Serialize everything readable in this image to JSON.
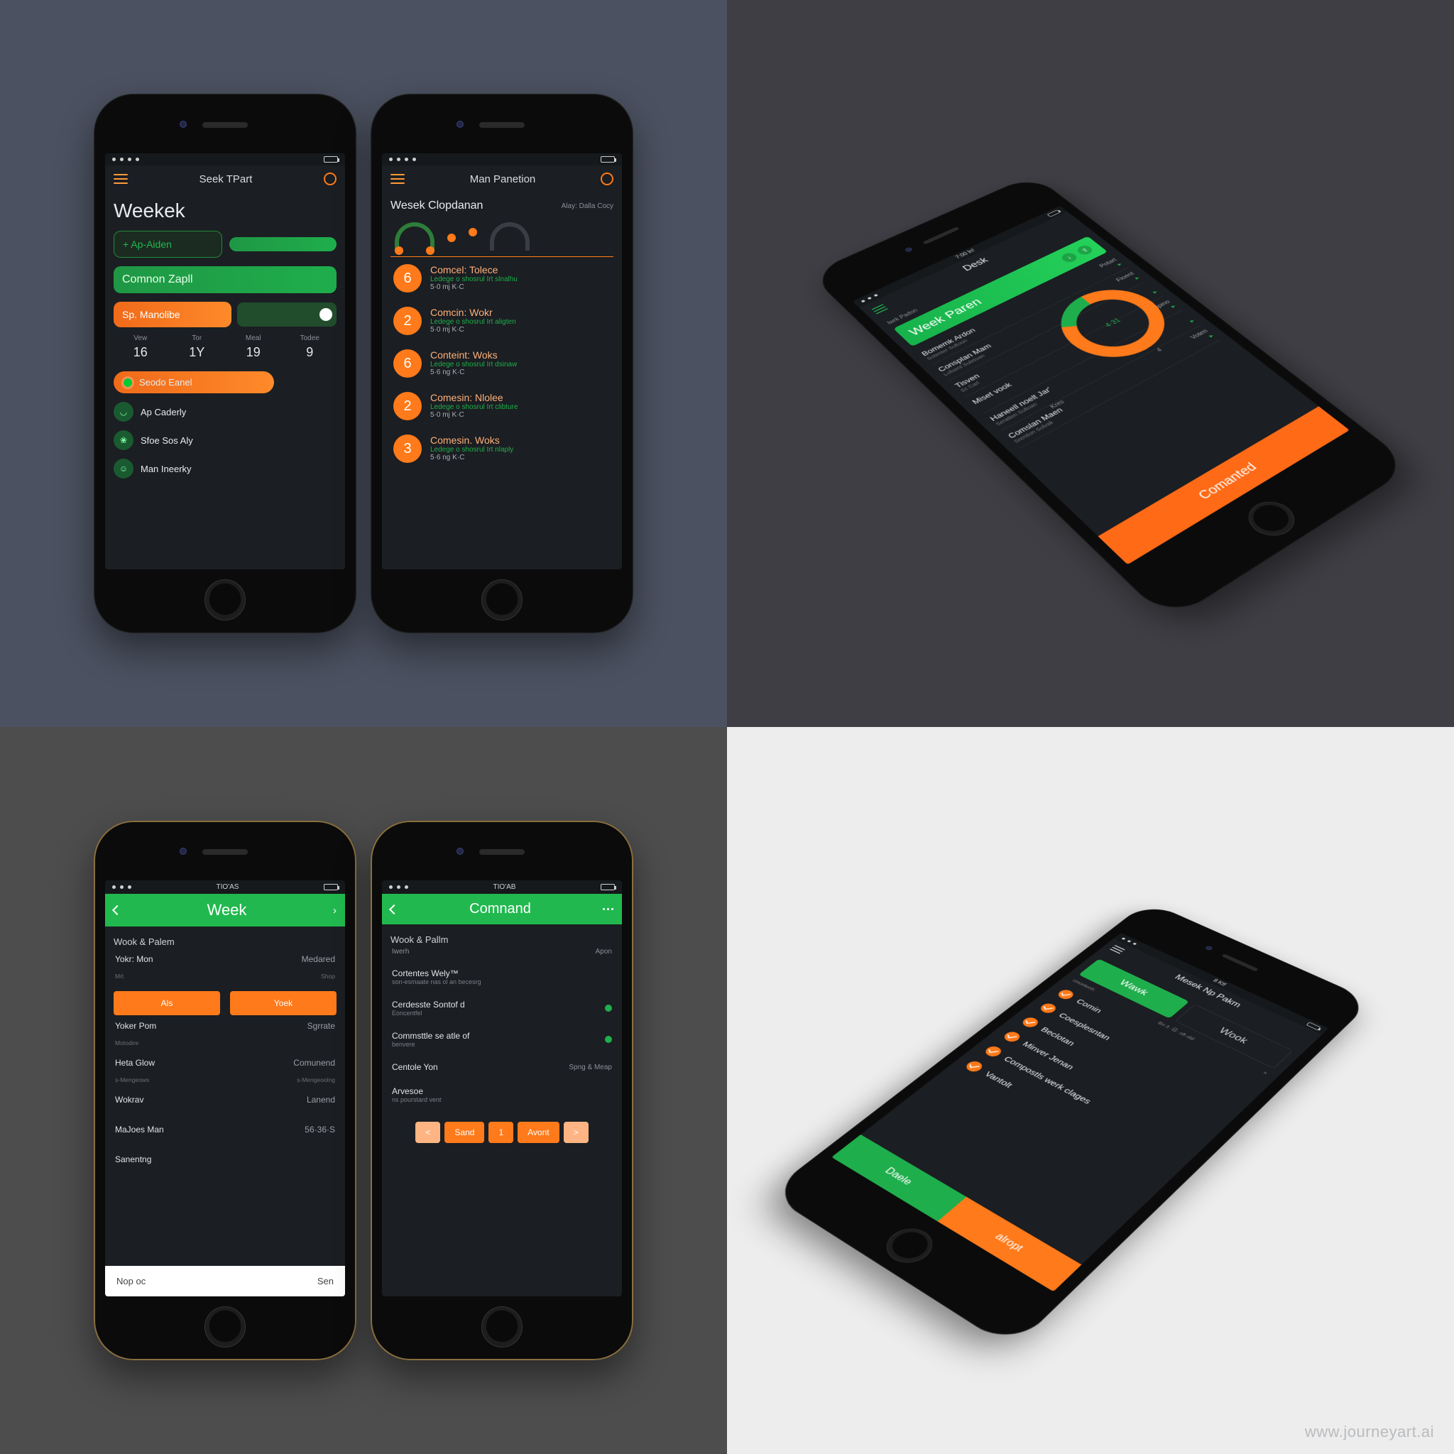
{
  "watermark": "www.journeyart.ai",
  "q1": {
    "left": {
      "status_time": "",
      "topbar_title": "Seek TPart",
      "h1": "Weekek",
      "add_btn": "+ Ap-Aiden",
      "banner": "Comnon Zapll",
      "action_btn": "Sp. Manolibe",
      "action_toggle_state": "on",
      "stats": [
        {
          "label": "Vew",
          "value": "16"
        },
        {
          "label": "Tor",
          "value": "1Y"
        },
        {
          "label": "Meal",
          "value": "19"
        },
        {
          "label": "Todee",
          "value": "9"
        }
      ],
      "toggle_chip": {
        "label": "Seodo Eanel",
        "on": true
      },
      "menu": [
        {
          "icon": "cup",
          "label": "Ap Caderly"
        },
        {
          "icon": "leaf",
          "label": "Sfoe Sos Aly"
        },
        {
          "icon": "user",
          "label": "Man Ineerky"
        }
      ]
    },
    "right": {
      "topbar_title": "Man Panetion",
      "subtitle": "Wesek Clopdanan",
      "sub_right": "Alay: Dalla Cocy",
      "items": [
        {
          "n": "6",
          "title": "Comcel: Tolece",
          "sub": "Ledege o shosrul Irt slnalhu",
          "meta": "5·0 mj  K·C"
        },
        {
          "n": "2",
          "title": "Comcin: Wokr",
          "sub": "Ledege o shosrul Irt aligten",
          "meta": "5·0 mj  K·C"
        },
        {
          "n": "6",
          "title": "Conteint: Woks",
          "sub": "Ledege o shosrul Irt dsinaw",
          "meta": "5·6 ng  K·C"
        },
        {
          "n": "2",
          "title": "Comesin: Nlolee",
          "sub": "Ledege o shosrul Irt clibture",
          "meta": "5·0 mj  K·C"
        },
        {
          "n": "3",
          "title": "Comesin. Woks",
          "sub": "Ledege o shosrul Irt nlaply",
          "meta": "5·6 ng  K·C"
        }
      ]
    }
  },
  "q2": {
    "status_time": "7:00 ln!",
    "topbar_title": "Desk",
    "small_above_banner": "Iwrk Padon",
    "banner": "Week Paren",
    "rows": [
      {
        "label": "Bomemk Ardon",
        "sub": "Sotenter Sultoun",
        "right": "Potart"
      },
      {
        "label": "Consplan Mam",
        "sub": "Lofoent Suletoan",
        "right": "Fioent"
      },
      {
        "label": "Tisven",
        "sub": "Sc  Carl",
        "right": ""
      },
      {
        "label": "Miset vook",
        "sub": "",
        "right": "Vdpino"
      },
      {
        "label": "Haneell noelt Jar'",
        "sub": "Seratten Sultoan",
        "right": ""
      },
      {
        "label": "Comslan Maen",
        "sub": "Srention Solvak",
        "right": "Voten"
      }
    ],
    "ring_text": "4·31",
    "bottom_small": [
      "Kres",
      "4"
    ],
    "cta": "Comanted"
  },
  "q3": {
    "left": {
      "topbar_title": "Week",
      "subtitle": "Wook & Palem",
      "cols": [
        {
          "l": "Yokr: Mon",
          "r": "Medared",
          "ls": "Mrl.",
          "rs": "Shop"
        },
        {
          "btnL": "Als",
          "btnR": "Yoek"
        },
        {
          "l": "Yoker Pom",
          "r": "Sgrrate",
          "ls": "Motodire",
          "rs": ""
        },
        {
          "l": "Heta Glow",
          "r": "Comunend",
          "ls": "s-Mengeows",
          "rs": "s-Mengeoolng"
        },
        {
          "l": "Wokrav",
          "r": "Lanend",
          "ls": "",
          "rs": ""
        },
        {
          "l": "MaJoes Man",
          "r": "56·36·S",
          "ls": "",
          "rs": ""
        },
        {
          "l": "Sanentng",
          "r": "",
          "ls": "",
          "rs": ""
        }
      ],
      "footer_left": "Nop oc",
      "footer_right": "Sen"
    },
    "right": {
      "topbar_title": "Comnand",
      "subtitle": "Wook & Pallm",
      "head_left": "Iwerh",
      "head_right": "Apon",
      "para1_t": "Cortentes Wely™",
      "para1_s": "son-esmaate nas ol an becesrg",
      "items": [
        {
          "t": "Cerdesste Sontof d",
          "s": "Eoncentfel",
          "dot": true
        },
        {
          "t": "Commsttle se atle of",
          "s": "benvere",
          "dot": true
        },
        {
          "t": "Centole Yon",
          "r": "Spng & Meap"
        },
        {
          "t": "Arvesoe",
          "s": "ns pourstard vent"
        }
      ],
      "pager": [
        "<",
        "Sand",
        "1",
        "Avont",
        ">"
      ]
    }
  },
  "q4": {
    "status_time": "8 Ktf",
    "topbar_title": "Mesek Np Pakm",
    "seg": [
      "Wawk",
      "Wook"
    ],
    "subline_l": "cmontenh:",
    "subline_r": "Bo 3 ·日· oft old",
    "close_mark": "×",
    "items": [
      "Comin",
      "Coesplesntan",
      "Beclotan",
      "Minver Jenan",
      "Compostls werk clages",
      "Vantolt"
    ],
    "footer": [
      "Daele",
      "alropt"
    ]
  }
}
